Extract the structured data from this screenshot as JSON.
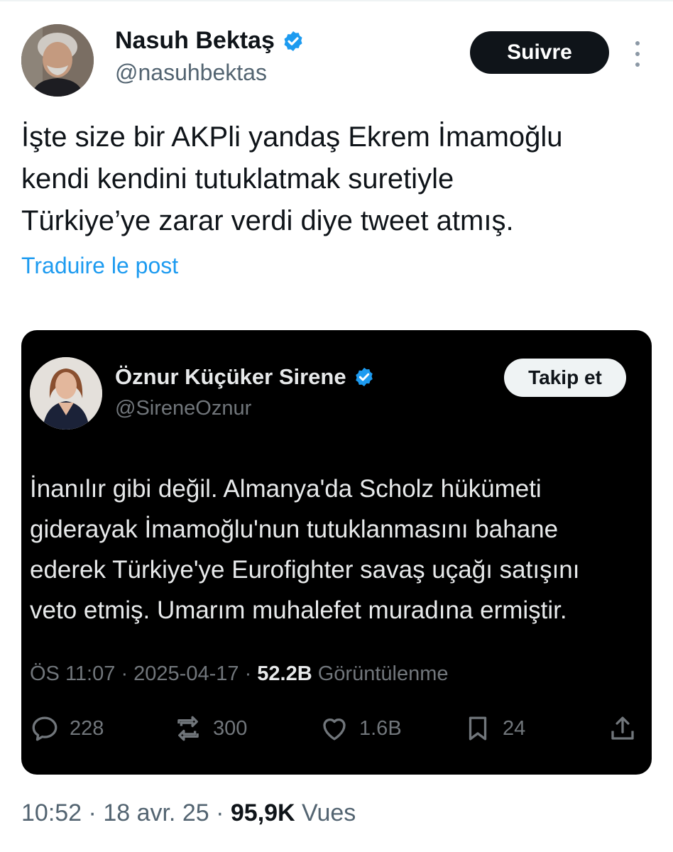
{
  "colors": {
    "verified_badge": "#1d9bf0",
    "link": "#1d9bf0",
    "text_primary": "#0f1419",
    "text_secondary": "#536471",
    "embed_background": "#000000"
  },
  "outer_tweet": {
    "author": {
      "name": "Nasuh Bektaş",
      "handle": "@nasuhbektas",
      "verified_icon": "verified-badge-icon"
    },
    "follow_label": "Suivre",
    "more_icon": "more-vertical-icon",
    "text_lines": [
      "İşte size bir AKPli yandaş Ekrem İmamoğlu",
      "kendi kendini tutuklatmak suretiyle",
      "Türkiye’ye zarar verdi diye tweet atmış."
    ],
    "translate_label": "Traduire le post",
    "meta": {
      "time": "10:52",
      "sep1": " · ",
      "date": "18 avr. 25",
      "sep2": " · ",
      "views_count": "95,9K",
      "views_label": " Vues"
    }
  },
  "embedded_tweet": {
    "author": {
      "name": "Öznur Küçüker Sirene",
      "handle": "@SireneOznur",
      "verified_icon": "verified-badge-icon"
    },
    "follow_label": "Takip et",
    "text_lines": [
      "İnanılır gibi değil. Almanya'da Scholz hükümeti",
      "giderayak İmamoğlu'nun tutuklanmasını bahane",
      "ederek Türkiye'ye Eurofighter savaş uçağı satışını",
      "veto etmiş. Umarım muhalefet muradına ermiştir."
    ],
    "meta": {
      "time": "ÖS 11:07",
      "sep1": " · ",
      "date": "2025-04-17",
      "sep2": " · ",
      "views_count": "52.2B",
      "views_label": " Görüntülenme"
    },
    "actions": {
      "replies": {
        "icon": "reply-icon",
        "count": "228"
      },
      "reposts": {
        "icon": "repost-icon",
        "count": "300"
      },
      "likes": {
        "icon": "heart-icon",
        "count": "1.6B"
      },
      "bookmarks": {
        "icon": "bookmark-icon",
        "count": "24"
      },
      "share": {
        "icon": "share-icon"
      }
    }
  }
}
